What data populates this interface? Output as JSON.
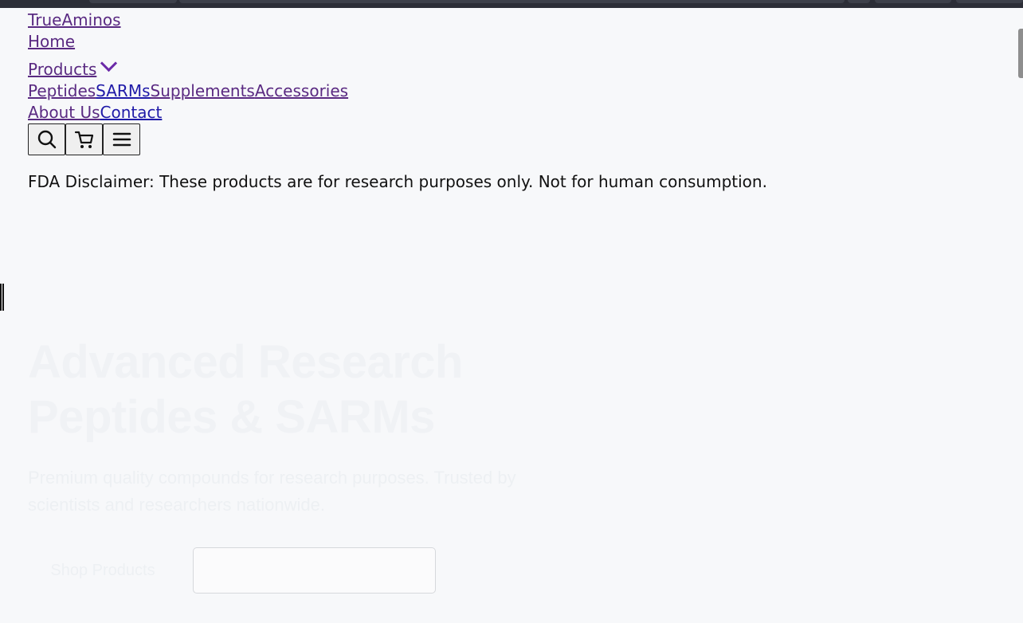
{
  "header": {
    "brand": "TrueAminos",
    "nav": {
      "home": "Home",
      "products": "Products",
      "about": "About Us",
      "contact": "Contact"
    },
    "subnav": [
      "Peptides",
      "SARMs",
      "Supplements",
      "Accessories"
    ],
    "icons": [
      "search-icon",
      "cart-icon",
      "menu-icon"
    ]
  },
  "notice": {
    "disclaimer": "FDA Disclaimer: These products are for research purposes only. Not for human consumption."
  },
  "hero": {
    "title_line_1": "Advanced Research",
    "title_line_2": "Peptides & SARMs",
    "subtitle_line_1": "Premium quality compounds for research purposes. Trusted by",
    "subtitle_line_2": "scientists and researchers nationwide.",
    "shop_button": "Shop Products"
  },
  "colors": {
    "link_purple": "#5a2a82",
    "link_blue": "#1f1aa8",
    "background": "#f7f8fa",
    "hero_text": "#f0f2f5"
  }
}
